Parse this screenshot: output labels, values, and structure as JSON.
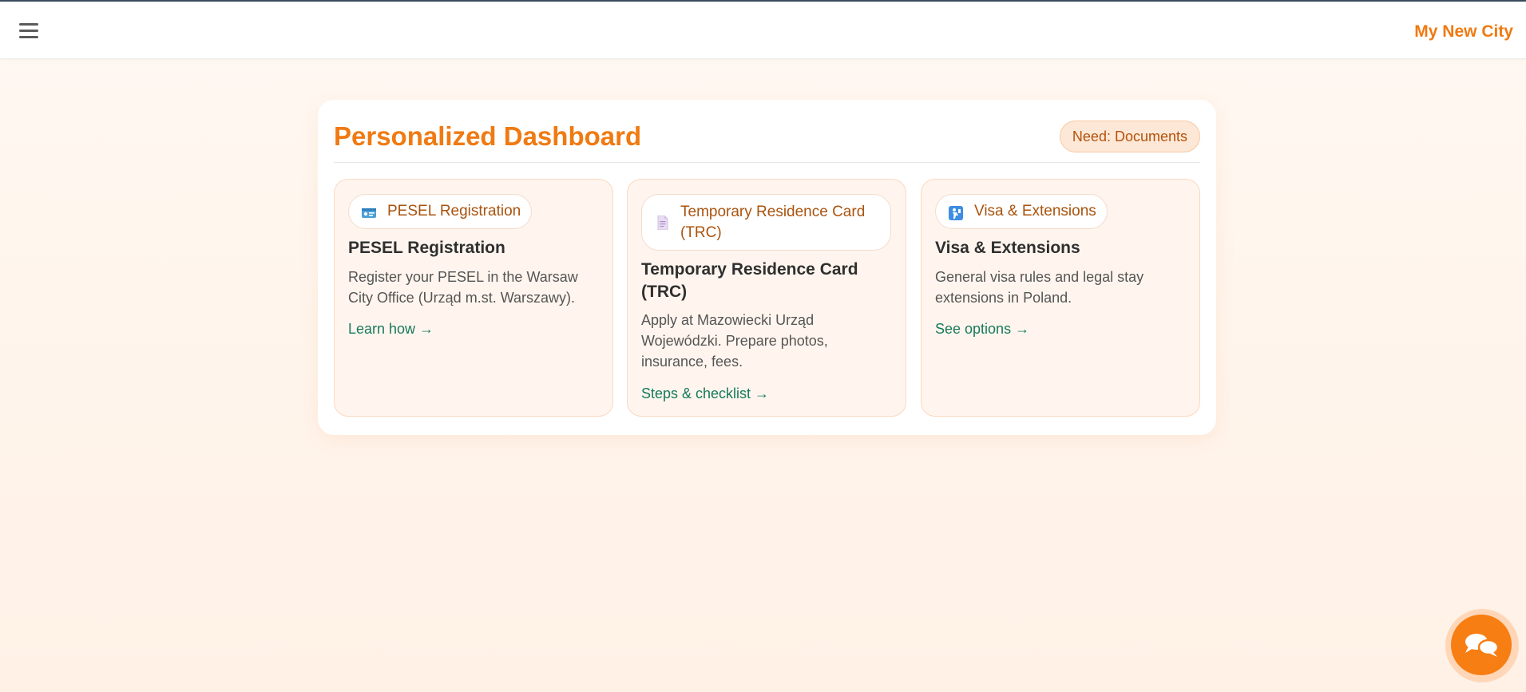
{
  "navbar": {
    "menu_icon": "hamburger-menu-icon",
    "brand": "My New City"
  },
  "dashboard": {
    "title": "Personalized Dashboard",
    "need_badge": "Need: Documents",
    "cards": [
      {
        "icon": "id-card-icon",
        "chip": "PESEL Registration",
        "title": "PESEL Registration",
        "description": "Register your PESEL in the Warsaw City Office (Urząd m.st. Warszawy).",
        "link": "Learn how →"
      },
      {
        "icon": "document-icon",
        "chip": "Temporary Residence Card (TRC)",
        "title": "Temporary Residence Card (TRC)",
        "description": "Apply at Mazowiecki Urząd Wojewódzki. Prepare photos, insurance, fees.",
        "link": "Steps & checklist →"
      },
      {
        "icon": "passport-control-icon",
        "chip": "Visa & Extensions",
        "title": "Visa & Extensions",
        "description": "General visa rules and legal stay extensions in Poland.",
        "link": "See options →"
      }
    ]
  },
  "chat": {
    "icon": "chat-bubbles-icon"
  },
  "colors": {
    "accent": "#f07a12",
    "link": "#167a5c",
    "card_bg": "#fff5ee"
  }
}
